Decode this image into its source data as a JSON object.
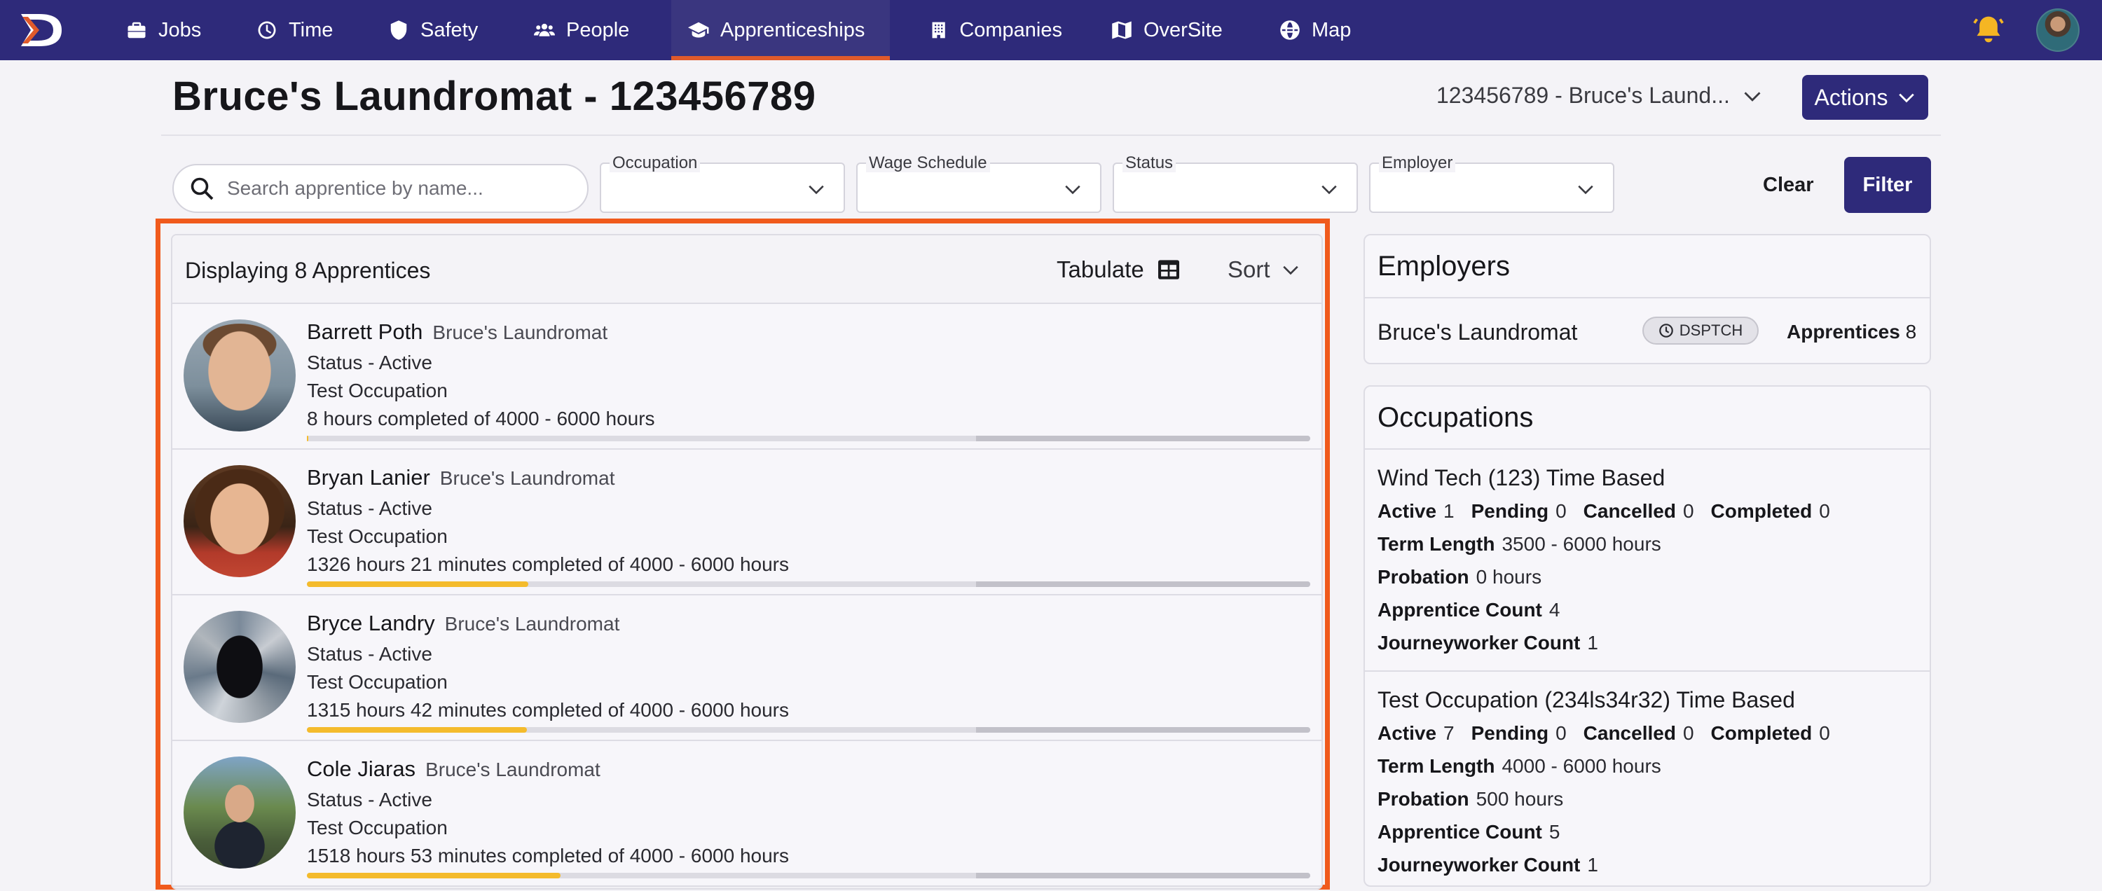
{
  "nav": {
    "items": [
      {
        "label": "Jobs",
        "icon": "briefcase-icon"
      },
      {
        "label": "Time",
        "icon": "clock-icon"
      },
      {
        "label": "Safety",
        "icon": "shield-icon"
      },
      {
        "label": "People",
        "icon": "people-icon"
      },
      {
        "label": "Apprenticeships",
        "icon": "graduation-cap-icon",
        "active": true
      },
      {
        "label": "Companies",
        "icon": "building-icon"
      },
      {
        "label": "OverSite",
        "icon": "map-folded-icon"
      },
      {
        "label": "Map",
        "icon": "globe-icon"
      }
    ],
    "accent": "#e05a2b",
    "background": "#2e2a7a"
  },
  "header": {
    "title": "Bruce's Laundromat - 123456789",
    "scope": "123456789 - Bruce's Laund...",
    "actions_label": "Actions"
  },
  "filters": {
    "search_placeholder": "Search apprentice by name...",
    "occupation_label": "Occupation",
    "wage_schedule_label": "Wage Schedule",
    "status_label": "Status",
    "employer_label": "Employer",
    "clear_label": "Clear",
    "filter_label": "Filter"
  },
  "list": {
    "count_text": "Displaying 8 Apprentices",
    "tabulate_label": "Tabulate",
    "sort_label": "Sort",
    "apprentices": [
      {
        "name": "Barrett Poth",
        "employer": "Bruce's Laundromat",
        "status": "Status - Active",
        "occupation": "Test Occupation",
        "hours": "8 hours completed of 4000 - 6000 hours",
        "progress": 0.0013
      },
      {
        "name": "Bryan Lanier",
        "employer": "Bruce's Laundromat",
        "status": "Status - Active",
        "occupation": "Test Occupation",
        "hours": "1326 hours 21 minutes completed of 4000 - 6000 hours",
        "progress": 0.221
      },
      {
        "name": "Bryce Landry",
        "employer": "Bruce's Laundromat",
        "status": "Status - Active",
        "occupation": "Test Occupation",
        "hours": "1315 hours 42 minutes completed of 4000 - 6000 hours",
        "progress": 0.219
      },
      {
        "name": "Cole Jiaras",
        "employer": "Bruce's Laundromat",
        "status": "Status - Active",
        "occupation": "Test Occupation",
        "hours": "1518 hours 53 minutes completed of 4000 - 6000 hours",
        "progress": 0.253
      }
    ],
    "min_hours_fraction": 0.667,
    "progress_color": "#f4bb2c"
  },
  "employers": {
    "title": "Employers",
    "items": [
      {
        "name": "Bruce's Laundromat",
        "badge": "DSPTCH",
        "count_label": "Apprentices",
        "count": "8"
      }
    ]
  },
  "occupations": {
    "title": "Occupations",
    "items": [
      {
        "title": "Wind Tech (123) Time Based",
        "active_label": "Active",
        "active": "1",
        "pending_label": "Pending",
        "pending": "0",
        "cancelled_label": "Cancelled",
        "cancelled": "0",
        "completed_label": "Completed",
        "completed": "0",
        "term_label": "Term Length",
        "term": "3500 - 6000 hours",
        "probation_label": "Probation",
        "probation": "0 hours",
        "apprentice_count_label": "Apprentice Count",
        "apprentice_count": "4",
        "journeyworker_label": "Journeyworker Count",
        "journeyworker": "1"
      },
      {
        "title": "Test Occupation (234ls34r32) Time Based",
        "active_label": "Active",
        "active": "7",
        "pending_label": "Pending",
        "pending": "0",
        "cancelled_label": "Cancelled",
        "cancelled": "0",
        "completed_label": "Completed",
        "completed": "0",
        "term_label": "Term Length",
        "term": "4000 - 6000 hours",
        "probation_label": "Probation",
        "probation": "500 hours",
        "apprentice_count_label": "Apprentice Count",
        "apprentice_count": "5",
        "journeyworker_label": "Journeyworker Count",
        "journeyworker": "1"
      }
    ]
  }
}
